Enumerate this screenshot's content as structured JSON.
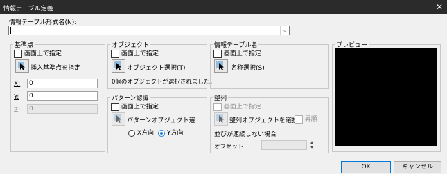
{
  "window": {
    "title": "情報テーブル定義",
    "close": "✕"
  },
  "format": {
    "label": "情報テーブル形式名(N):",
    "value": ""
  },
  "base_point": {
    "legend": "基準点",
    "on_screen_label": "画面上で指定",
    "insert_button_label": "挿入基準点を指定",
    "x_label": "X:",
    "x_value": "0",
    "y_label": "Y:",
    "y_value": "0",
    "z_label": "Z:",
    "z_value": "0"
  },
  "objects": {
    "legend": "オブジェクト",
    "on_screen_label": "画面上で指定",
    "select_button_label": "オブジェクト選択(T)",
    "status_text": "0個のオブジェクトが選択されました。"
  },
  "table_name": {
    "legend": "情報テーブル名",
    "on_screen_label": "画面上で指定",
    "select_button_label": "名称選択(S)"
  },
  "pattern": {
    "legend": "パターン認識",
    "on_screen_label": "画面上で指定",
    "select_button_label": "パターンオブジェクト選",
    "radio_x_label": "X方向",
    "radio_y_label": "Y方向",
    "selected": "Y方向"
  },
  "align": {
    "legend": "整列",
    "on_screen_label": "画面上で指定",
    "select_button_label": "整列オブジェクトを選択",
    "asc_label": "昇順",
    "not_continuous_label": "並びが連続しない場合",
    "offset_label": "オフセット",
    "offset_value": ""
  },
  "preview": {
    "legend": "プレビュー"
  },
  "buttons": {
    "ok": "OK",
    "cancel": "キャンセル"
  },
  "colors": {
    "title_bg": "#2b2b2b",
    "preview_bg": "#000000",
    "accent": "#0078d7"
  }
}
